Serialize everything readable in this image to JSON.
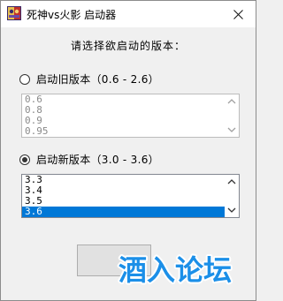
{
  "window": {
    "title": "死神vs火影 启动器",
    "icon": "bleach-vs-naruto-app-icon",
    "close_icon": "close-icon"
  },
  "prompt": "请选择欲启动的版本：",
  "old_version": {
    "label": "启动旧版本（0.6 - 2.6）",
    "selected": false,
    "enabled": false,
    "items": [
      "0.6",
      "0.8",
      "0.9",
      "0.95"
    ]
  },
  "new_version": {
    "label": "启动新版本（3.0 - 3.6）",
    "selected": true,
    "enabled": true,
    "items": [
      "3.3",
      "3.4",
      "3.5",
      "3.6"
    ],
    "selected_item": "3.6"
  },
  "start_button": {
    "label": ""
  },
  "watermark": {
    "text": "酒入论坛",
    "color": "#1b8fe8"
  },
  "colors": {
    "selection": "#0078d7",
    "window_bg": "#f0f0f0"
  }
}
